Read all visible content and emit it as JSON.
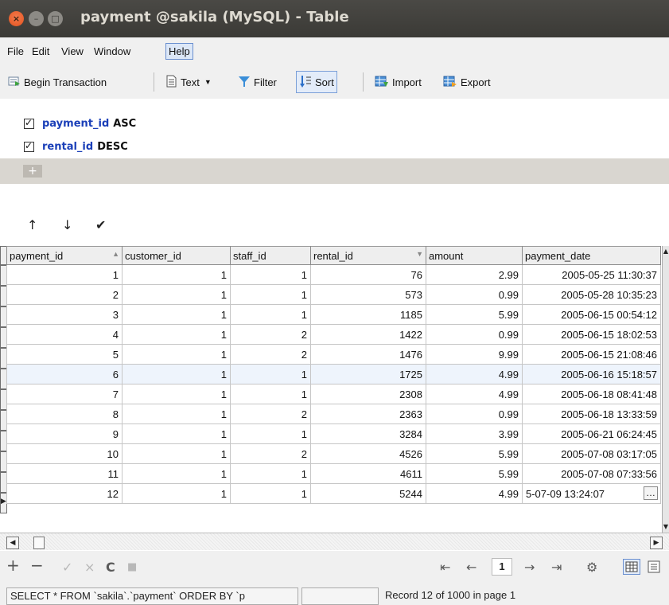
{
  "window": {
    "title": "payment @sakila (MySQL) - Table",
    "close_glyph": "×",
    "min_glyph": "–",
    "max_glyph": "□"
  },
  "menu": [
    "File",
    "Edit",
    "View",
    "Window",
    "Help"
  ],
  "toolbar": {
    "begin_transaction": "Begin Transaction",
    "text": "Text",
    "filter": "Filter",
    "sort": "Sort",
    "import": "Import",
    "export": "Export"
  },
  "sort_fields": [
    {
      "field": "payment_id",
      "direction": "ASC",
      "checked": true
    },
    {
      "field": "rental_id",
      "direction": "DESC",
      "checked": true
    }
  ],
  "sort_add": "+",
  "sort_controls": {
    "up": "↑",
    "down": "↓",
    "apply": "✔"
  },
  "grid": {
    "columns": [
      "payment_id",
      "customer_id",
      "staff_id",
      "rental_id",
      "amount",
      "payment_date"
    ],
    "sort_indicator_payment_id": "▲",
    "sort_indicator_rental_id": "▼",
    "rows": [
      [
        "1",
        "1",
        "1",
        "76",
        "2.99",
        "2005-05-25 11:30:37"
      ],
      [
        "2",
        "1",
        "1",
        "573",
        "0.99",
        "2005-05-28 10:35:23"
      ],
      [
        "3",
        "1",
        "1",
        "1185",
        "5.99",
        "2005-06-15 00:54:12"
      ],
      [
        "4",
        "1",
        "2",
        "1422",
        "0.99",
        "2005-06-15 18:02:53"
      ],
      [
        "5",
        "1",
        "2",
        "1476",
        "9.99",
        "2005-06-15 21:08:46"
      ],
      [
        "6",
        "1",
        "1",
        "1725",
        "4.99",
        "2005-06-16 15:18:57"
      ],
      [
        "7",
        "1",
        "1",
        "2308",
        "4.99",
        "2005-06-18 08:41:48"
      ],
      [
        "8",
        "1",
        "2",
        "2363",
        "0.99",
        "2005-06-18 13:33:59"
      ],
      [
        "9",
        "1",
        "1",
        "3284",
        "3.99",
        "2005-06-21 06:24:45"
      ],
      [
        "10",
        "1",
        "2",
        "4526",
        "5.99",
        "2005-07-08 03:17:05"
      ],
      [
        "11",
        "1",
        "1",
        "4611",
        "5.99",
        "2005-07-08 07:33:56"
      ],
      [
        "12",
        "1",
        "1",
        "5244",
        "4.99",
        "5-07-09 13:24:07"
      ]
    ],
    "current_row": 12,
    "highlight_row": 6
  },
  "nav": {
    "page": "1",
    "add": "+",
    "delete": "−",
    "apply": "✓",
    "discard": "×",
    "refresh": "C",
    "stop": "■",
    "first": "⇤",
    "prev": "←",
    "next": "→",
    "last": "⇥",
    "settings": "⚙"
  },
  "status": {
    "sql": "SELECT * FROM `sakila`.`payment` ORDER BY `p",
    "record": "Record 12 of 1000 in page 1"
  }
}
